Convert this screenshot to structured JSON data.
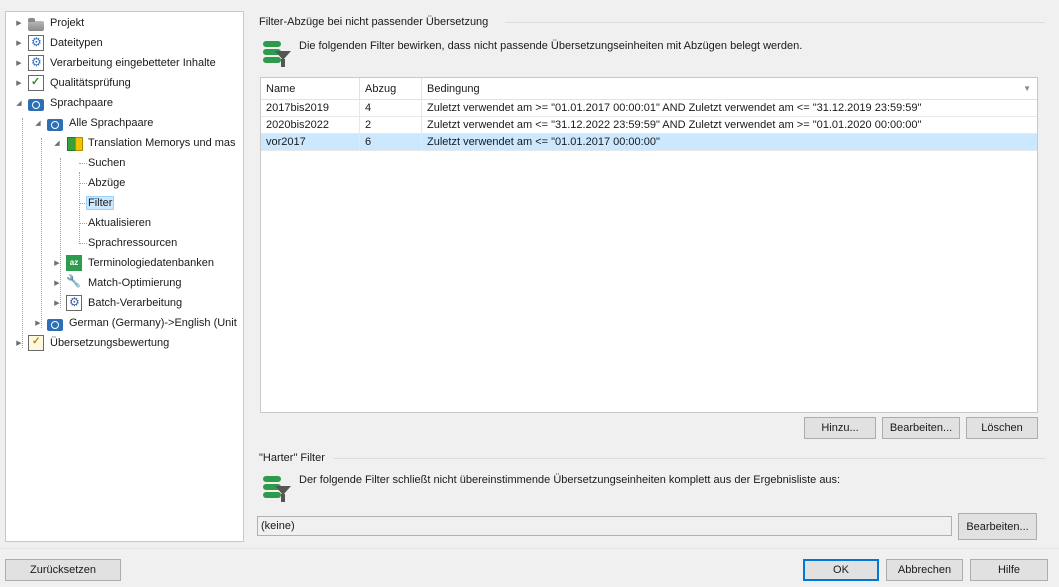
{
  "tree": {
    "items": [
      {
        "label": "Projekt",
        "icon": "folder-icon"
      },
      {
        "label": "Dateitypen",
        "icon": "gear-icon"
      },
      {
        "label": "Verarbeitung eingebetteter Inhalte",
        "icon": "gear-icon"
      },
      {
        "label": "Qualitätsprüfung",
        "icon": "checklist-icon"
      },
      {
        "label": "Sprachpaare",
        "icon": "language-pair-icon"
      },
      {
        "label": "Alle Sprachpaare",
        "icon": "language-pair-icon"
      },
      {
        "label": "Translation Memorys und mas",
        "icon": "translation-memory-icon"
      },
      {
        "label": "Suchen"
      },
      {
        "label": "Abzüge"
      },
      {
        "label": "Filter"
      },
      {
        "label": "Aktualisieren"
      },
      {
        "label": "Sprachressourcen"
      },
      {
        "label": "Terminologiedatenbanken",
        "icon": "termbase-icon"
      },
      {
        "label": "Match-Optimierung",
        "icon": "wrench-icon"
      },
      {
        "label": "Batch-Verarbeitung",
        "icon": "batch-icon"
      },
      {
        "label": "German (Germany)->English (Unit",
        "icon": "language-pair-icon"
      },
      {
        "label": "Übersetzungsbewertung",
        "icon": "evaluation-icon"
      }
    ],
    "selected": "Filter"
  },
  "filter_penalties": {
    "title": "Filter-Abzüge bei nicht passender Übersetzung",
    "description": "Die folgenden Filter bewirken, dass nicht passende Übersetzungseinheiten mit Abzügen belegt werden.",
    "columns": [
      "Name",
      "Abzug",
      "Bedingung"
    ],
    "rows": [
      {
        "name": "2017bis2019",
        "penalty": "4",
        "condition": "Zuletzt verwendet am >= \"01.01.2017 00:00:01\" AND Zuletzt verwendet am <= \"31.12.2019 23:59:59\""
      },
      {
        "name": "2020bis2022",
        "penalty": "2",
        "condition": "Zuletzt verwendet am <= \"31.12.2022 23:59:59\" AND Zuletzt verwendet am >= \"01.01.2020 00:00:00\""
      },
      {
        "name": "vor2017",
        "penalty": "6",
        "condition": "Zuletzt verwendet am <= \"01.01.2017 00:00:00\""
      }
    ],
    "selected_row": "vor2017",
    "buttons": {
      "add": "Hinzu...",
      "edit": "Bearbeiten...",
      "delete": "Löschen"
    }
  },
  "hard_filter": {
    "title": "\"Harter\" Filter",
    "description": "Der folgende Filter schließt nicht übereinstimmende Übersetzungseinheiten komplett aus der Ergebnisliste aus:",
    "value": "(keine)",
    "edit_button": "Bearbeiten..."
  },
  "footer": {
    "reset": "Zurücksetzen",
    "ok": "OK",
    "cancel": "Abbrechen",
    "help": "Hilfe"
  },
  "colors": {
    "selection": "#cce8ff",
    "accent": "#0078d7",
    "icon_green": "#2e9a4b"
  }
}
